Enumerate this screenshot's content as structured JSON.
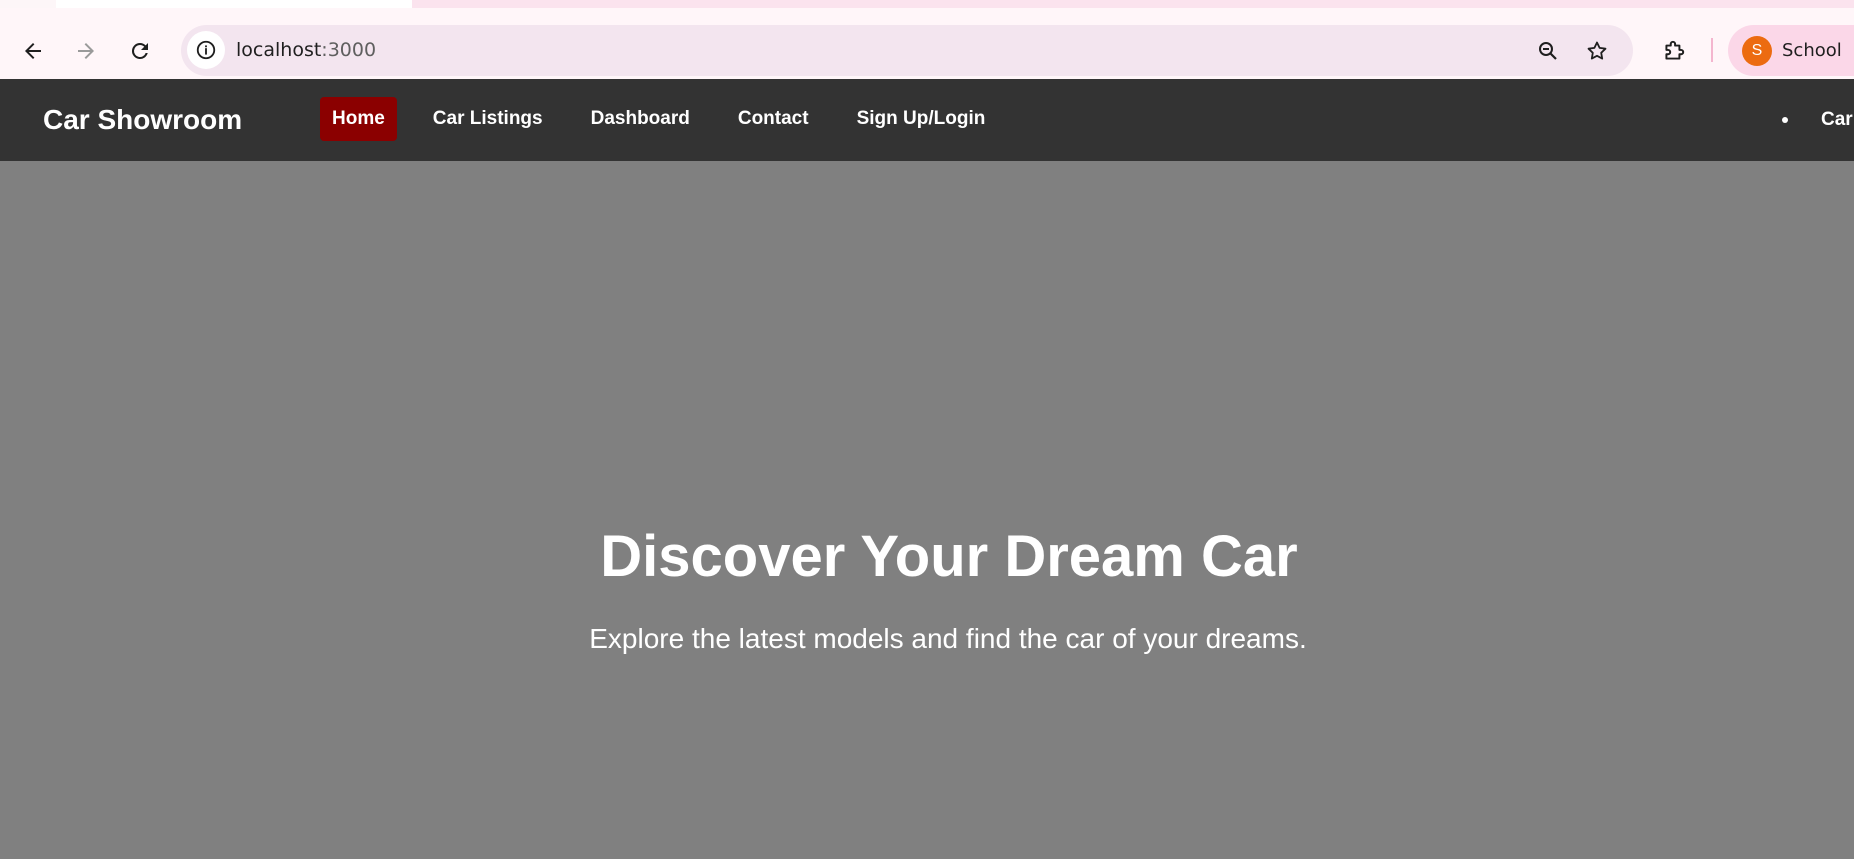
{
  "browser": {
    "url_host": "localhost",
    "url_port": ":3000",
    "profile_initial": "S",
    "profile_name": "School",
    "colors": {
      "omnibox": "#f3e5ef",
      "profile_chip": "#fbd7e8",
      "avatar": "#ec6b10"
    }
  },
  "site": {
    "brand": "Car Showroom",
    "nav": {
      "items": [
        {
          "label": "Home",
          "active": true
        },
        {
          "label": "Car Listings",
          "active": false
        },
        {
          "label": "Dashboard",
          "active": false
        },
        {
          "label": "Contact",
          "active": false
        },
        {
          "label": "Sign Up/Login",
          "active": false
        }
      ],
      "extra_label": "Car"
    },
    "hero": {
      "title": "Discover Your Dream Car",
      "subtitle": "Explore the latest models and find the car of your dreams."
    },
    "colors": {
      "navbar": "#333333",
      "active_nav": "#8b0000",
      "hero_background": "#808080"
    }
  }
}
